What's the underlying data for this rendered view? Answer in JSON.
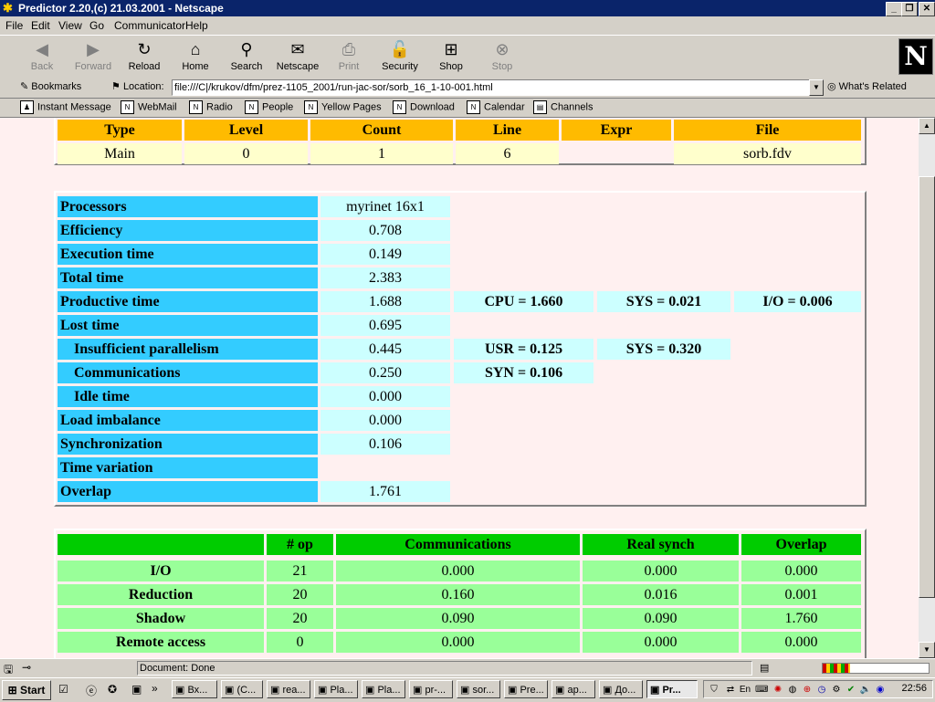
{
  "window": {
    "title": "Predictor 2.20,(c) 21.03.2001 - Netscape"
  },
  "menu": [
    "File",
    "Edit",
    "View",
    "Go",
    "Communicator",
    "Help"
  ],
  "nav": {
    "buttons": [
      {
        "label": "Back",
        "enabled": false,
        "icon": "back-arrow-icon"
      },
      {
        "label": "Forward",
        "enabled": false,
        "icon": "forward-arrow-icon"
      },
      {
        "label": "Reload",
        "enabled": true,
        "icon": "reload-icon"
      },
      {
        "label": "Home",
        "enabled": true,
        "icon": "home-icon"
      },
      {
        "label": "Search",
        "enabled": true,
        "icon": "search-icon"
      },
      {
        "label": "Netscape",
        "enabled": true,
        "icon": "netscape-icon"
      },
      {
        "label": "Print",
        "enabled": false,
        "icon": "print-icon"
      },
      {
        "label": "Security",
        "enabled": true,
        "icon": "lock-icon"
      },
      {
        "label": "Shop",
        "enabled": true,
        "icon": "shop-icon"
      },
      {
        "label": "Stop",
        "enabled": false,
        "icon": "stop-icon"
      }
    ]
  },
  "location": {
    "bookmarks_label": "Bookmarks",
    "location_label": "Location:",
    "url": "file:///C|/krukov/dfm/prez-1105_2001/run-jac-sor/sorb_16_1-10-001.html",
    "whats_related": "What's Related"
  },
  "personal": [
    "Instant Message",
    "WebMail",
    "Radio",
    "People",
    "Yellow Pages",
    "Download",
    "Calendar",
    "Channels"
  ],
  "table1": {
    "headers": [
      "Type",
      "Level",
      "Count",
      "Line",
      "Expr",
      "File"
    ],
    "row": [
      "Main",
      "0",
      "1",
      "6",
      "",
      "sorb.fdv"
    ]
  },
  "table2": {
    "rows": [
      {
        "label": "Processors",
        "value": "myrinet 16x1"
      },
      {
        "label": "Efficiency",
        "value": "0.708"
      },
      {
        "label": "Execution time",
        "value": "0.149"
      },
      {
        "label": "Total time",
        "value": "2.383"
      },
      {
        "label": "Productive time",
        "value": "1.688",
        "extra": [
          "CPU = 1.660",
          "SYS = 0.021",
          "I/O = 0.006"
        ]
      },
      {
        "label": "Lost time",
        "value": "0.695"
      },
      {
        "label": "Insufficient parallelism",
        "value": "0.445",
        "extra": [
          "USR = 0.125",
          "SYS = 0.320"
        ]
      },
      {
        "label": "Communications",
        "value": "0.250",
        "extra": [
          "SYN = 0.106"
        ]
      },
      {
        "label": "Idle time",
        "value": "0.000"
      },
      {
        "label": "Load imbalance",
        "value": "0.000"
      },
      {
        "label": "Synchronization",
        "value": "0.106"
      },
      {
        "label": "Time variation",
        "value": ""
      },
      {
        "label": "Overlap",
        "value": "1.761"
      }
    ]
  },
  "table3": {
    "headers": [
      "",
      "# op",
      "Communications",
      "Real synch",
      "Overlap"
    ],
    "rows": [
      [
        "I/O",
        "21",
        "0.000",
        "0.000",
        "0.000"
      ],
      [
        "Reduction",
        "20",
        "0.160",
        "0.016",
        "0.001"
      ],
      [
        "Shadow",
        "20",
        "0.090",
        "0.090",
        "1.760"
      ],
      [
        "Remote access",
        "0",
        "0.000",
        "0.000",
        "0.000"
      ]
    ]
  },
  "status": {
    "text": "Document: Done"
  },
  "taskbar": {
    "start": "Start",
    "items": [
      "Вх...",
      "(C...",
      "rea...",
      "Pla...",
      "Pla...",
      "pr-...",
      "sor...",
      "Pre...",
      "ap...",
      "До...",
      "Pr..."
    ],
    "active_index": 10,
    "lang": "En",
    "clock": "22:56"
  }
}
